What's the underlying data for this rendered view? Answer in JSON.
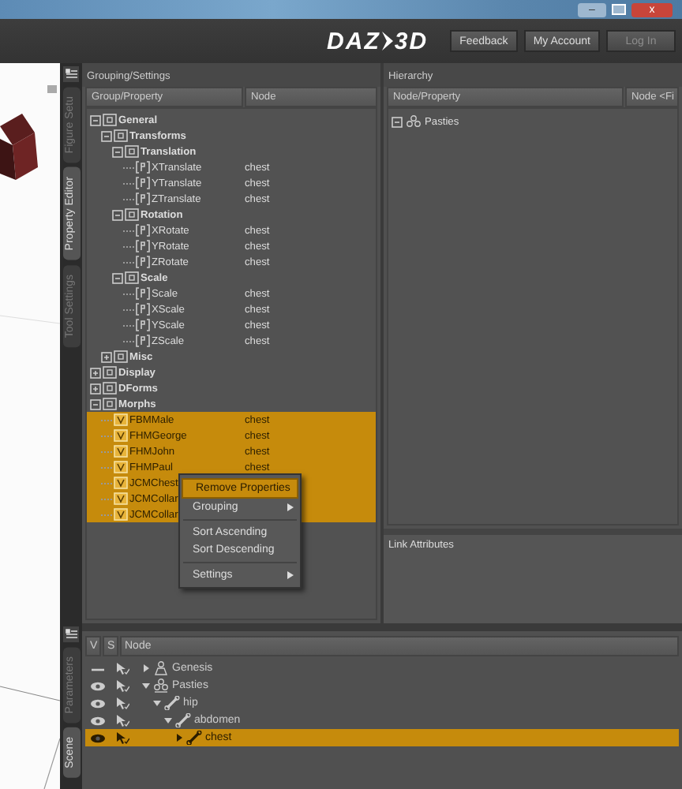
{
  "window": {
    "minimize": "–",
    "close": "x"
  },
  "header": {
    "logo_left": "DAZ",
    "logo_right": "3D",
    "buttons": [
      {
        "label": "Feedback",
        "disabled": false
      },
      {
        "label": "My Account",
        "disabled": false
      },
      {
        "label": "Log In",
        "disabled": true
      }
    ]
  },
  "side_tabs": [
    {
      "label": "Figure Setu",
      "selected": false
    },
    {
      "label": "Property Editor",
      "selected": true
    },
    {
      "label": "Tool Settings",
      "selected": false
    }
  ],
  "grouping_panel": {
    "title": "Grouping/Settings",
    "columns": [
      "Group/Property",
      "Node"
    ],
    "tree": [
      {
        "label": "General",
        "kind": "group",
        "expanded": true,
        "selected": false,
        "children": [
          {
            "label": "Transforms",
            "kind": "group",
            "expanded": true,
            "selected": false,
            "children": [
              {
                "label": "Translation",
                "kind": "group",
                "expanded": true,
                "selected": false,
                "children": [
                  {
                    "label": "XTranslate",
                    "kind": "property",
                    "node": "chest",
                    "selected": false
                  },
                  {
                    "label": "YTranslate",
                    "kind": "property",
                    "node": "chest",
                    "selected": false
                  },
                  {
                    "label": "ZTranslate",
                    "kind": "property",
                    "node": "chest",
                    "selected": false
                  }
                ]
              },
              {
                "label": "Rotation",
                "kind": "group",
                "expanded": true,
                "selected": false,
                "children": [
                  {
                    "label": "XRotate",
                    "kind": "property",
                    "node": "chest",
                    "selected": false
                  },
                  {
                    "label": "YRotate",
                    "kind": "property",
                    "node": "chest",
                    "selected": false
                  },
                  {
                    "label": "ZRotate",
                    "kind": "property",
                    "node": "chest",
                    "selected": false
                  }
                ]
              },
              {
                "label": "Scale",
                "kind": "group",
                "expanded": true,
                "selected": false,
                "children": [
                  {
                    "label": "Scale",
                    "kind": "property",
                    "node": "chest",
                    "selected": false
                  },
                  {
                    "label": "XScale",
                    "kind": "property",
                    "node": "chest",
                    "selected": false
                  },
                  {
                    "label": "YScale",
                    "kind": "property",
                    "node": "chest",
                    "selected": false
                  },
                  {
                    "label": "ZScale",
                    "kind": "property",
                    "node": "chest",
                    "selected": false
                  }
                ]
              }
            ]
          },
          {
            "label": "Misc",
            "kind": "group",
            "expanded": false,
            "selected": false
          }
        ]
      },
      {
        "label": "Display",
        "kind": "group",
        "expanded": false,
        "selected": false
      },
      {
        "label": "DForms",
        "kind": "group",
        "expanded": false,
        "selected": false
      },
      {
        "label": "Morphs",
        "kind": "group",
        "expanded": true,
        "selected": false,
        "children": [
          {
            "label": "FBMMale",
            "kind": "morph",
            "node": "chest",
            "selected": true
          },
          {
            "label": "FHMGeorge",
            "kind": "morph",
            "node": "chest",
            "selected": true
          },
          {
            "label": "FHMJohn",
            "kind": "morph",
            "node": "chest",
            "selected": true
          },
          {
            "label": "FHMPaul",
            "kind": "morph",
            "node": "chest",
            "selected": true
          },
          {
            "label": "JCMChest",
            "kind": "morph",
            "selected": true
          },
          {
            "label": "JCMCollar",
            "kind": "morph",
            "selected": true
          },
          {
            "label": "JCMCollar",
            "kind": "morph",
            "selected": true
          }
        ]
      }
    ]
  },
  "context_menu": [
    {
      "kind": "item",
      "label": "Remove Properties",
      "selected": true,
      "submenu": false
    },
    {
      "kind": "item",
      "label": "Grouping",
      "selected": false,
      "submenu": true
    },
    {
      "kind": "separator"
    },
    {
      "kind": "item",
      "label": "Sort Ascending",
      "selected": false,
      "submenu": false
    },
    {
      "kind": "item",
      "label": "Sort Descending",
      "selected": false,
      "submenu": false
    },
    {
      "kind": "separator"
    },
    {
      "kind": "item",
      "label": "Settings",
      "selected": false,
      "submenu": true
    }
  ],
  "hierarchy_panel": {
    "title": "Hierarchy",
    "columns": [
      "Node/Property",
      "Node <Fi"
    ],
    "rows": [
      {
        "label": "Pasties",
        "expanded": true
      }
    ],
    "link_attributes": "Link Attributes"
  },
  "scene_tabs": [
    {
      "label": "Parameters",
      "selected": false
    },
    {
      "label": "Scene",
      "selected": true
    }
  ],
  "scene_panel": {
    "columns": [
      "V",
      "S",
      "Node"
    ],
    "nodes": [
      {
        "label": "Genesis",
        "kind": "figure",
        "visible": false,
        "expanded": false,
        "selected": false
      },
      {
        "label": "Pasties",
        "kind": "group",
        "visible": true,
        "expanded": true,
        "selected": false,
        "children": [
          {
            "label": "hip",
            "kind": "bone",
            "visible": true,
            "expanded": true,
            "selected": false,
            "children": [
              {
                "label": "abdomen",
                "kind": "bone",
                "visible": true,
                "expanded": true,
                "selected": false,
                "children": [
                  {
                    "label": "chest",
                    "kind": "bone",
                    "visible": true,
                    "expanded": false,
                    "selected": true
                  }
                ]
              }
            ]
          }
        ]
      }
    ]
  }
}
